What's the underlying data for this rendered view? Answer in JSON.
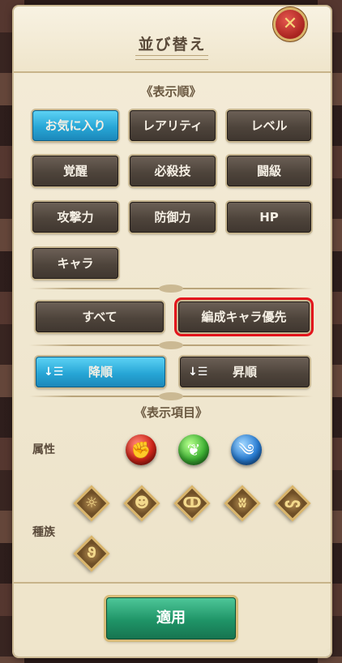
{
  "title": "並び替え",
  "close_label": "✕",
  "sort_section_title": "《表示順》",
  "sort_buttons": [
    {
      "label": "お気に入り"
    },
    {
      "label": "レアリティ"
    },
    {
      "label": "レベル"
    },
    {
      "label": "覚醒"
    },
    {
      "label": "必殺技"
    },
    {
      "label": "闘級"
    },
    {
      "label": "攻撃力"
    },
    {
      "label": "防御力"
    },
    {
      "label": "HP"
    },
    {
      "label": "キャラ"
    }
  ],
  "filter_all_label": "すべて",
  "filter_team_label": "編成キャラ優先",
  "order_desc_label": "降順",
  "order_asc_label": "昇順",
  "order_desc_icon": "↓☰",
  "order_asc_icon": "↓☰",
  "display_section_title": "《表示項目》",
  "attribute_label": "属性",
  "tribe_label": "種族",
  "attribute_orbs": [
    {
      "icon": "fist-icon",
      "glyph": "✊",
      "color": "#d3261a"
    },
    {
      "icon": "leaf-icon",
      "glyph": "❦",
      "color": "#3fb334"
    },
    {
      "icon": "wind-icon",
      "glyph": "༄",
      "color": "#2a7fd6"
    }
  ],
  "tribe_icons": [
    {
      "icon": "sun-icon",
      "glyph": "☼"
    },
    {
      "icon": "mask-icon",
      "glyph": "☻"
    },
    {
      "icon": "claw-icon",
      "glyph": "ↀ"
    },
    {
      "icon": "wings-icon",
      "glyph": "ʬ"
    },
    {
      "icon": "serpent-icon",
      "glyph": "ᔕ"
    },
    {
      "icon": "spiral-icon",
      "glyph": "ϑ"
    }
  ],
  "apply_label": "適用",
  "colors": {
    "active_button": "#27a6d6",
    "apply_button": "#1f9467",
    "highlight_border": "#e3141c"
  }
}
